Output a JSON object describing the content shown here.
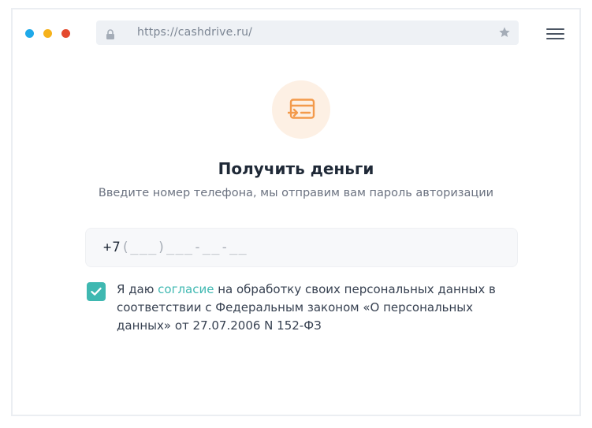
{
  "window": {
    "traffic_lights": [
      "#1fa9e9",
      "#f6b21b",
      "#e4492d"
    ]
  },
  "browser": {
    "url": "https://cashdrive.ru/",
    "lock_icon": "lock-icon",
    "star_icon": "star-icon",
    "menu_icon": "hamburger-menu-icon"
  },
  "main": {
    "icon": "card-transfer-icon",
    "accent_color": "#f39a4b",
    "title": "Получить деньги",
    "subtitle": "Введите номер телефона, мы отправим вам пароль авторизации",
    "phone": {
      "prefix": "+7",
      "mask": "(___)___-__-__"
    },
    "consent": {
      "checked": true,
      "text_before": "Я даю ",
      "link_text": "согласие",
      "text_after": " на обработку своих персональных данных в соответствии с Федеральным законом «О персональных данных» от 27.07.2006 N 152-ФЗ",
      "check_color": "#3fb8b1"
    }
  }
}
